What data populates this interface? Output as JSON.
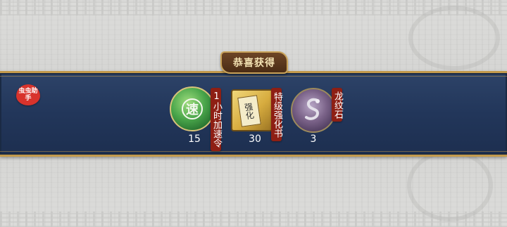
{
  "title": "恭喜获得",
  "helper_badge": "虫虫助手",
  "rewards": [
    {
      "name": "1小时加速令",
      "count": "15",
      "icon": "speed-token-icon",
      "glyph": "速"
    },
    {
      "name": "特级强化书",
      "count": "30",
      "icon": "enhance-book-icon",
      "glyph": "强化"
    },
    {
      "name": "龙纹石",
      "count": "3",
      "icon": "dragon-stone-icon"
    }
  ],
  "colors": {
    "band": "#22365a",
    "gold_border": "#c39a4c",
    "label_red": "#8e1f14",
    "title_brown": "#4a2c15"
  }
}
